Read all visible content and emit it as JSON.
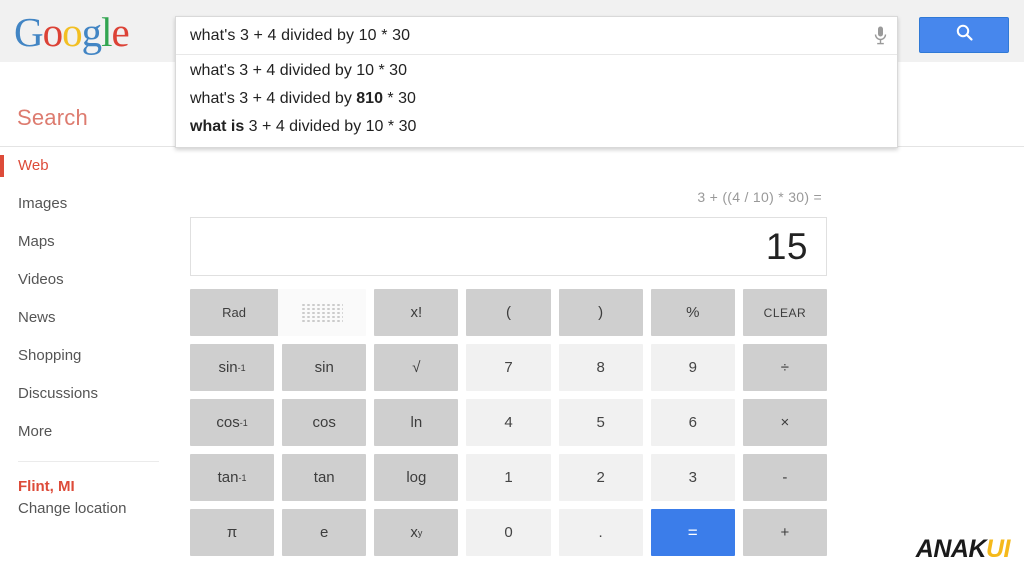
{
  "brand": {
    "logo_letters": [
      "G",
      "o",
      "o",
      "g",
      "l",
      "e"
    ],
    "colors": {
      "blue": "#4285c4",
      "red": "#dc4236",
      "yellow": "#f2bf23",
      "green": "#32a551",
      "accent_red": "#dd4b39",
      "button_blue": "#4787ed",
      "equals_blue": "#3b7dea"
    }
  },
  "header": {
    "search_label": "Search",
    "search_button_icon": "search-icon",
    "mic_icon": "microphone-icon"
  },
  "search": {
    "query": "what's 3 + 4 divided by 10 * 30",
    "placeholder": "Search",
    "suggestions": [
      {
        "plain_before": "what's 3 + 4 divided by 10 * 30",
        "bold": "",
        "plain_after": ""
      },
      {
        "plain_before": "what's 3 + 4 divided by ",
        "bold": "810",
        "plain_after": " * 30"
      },
      {
        "plain_before": "",
        "bold": "what is",
        "plain_after": " 3 + 4 divided by 10 * 30"
      }
    ]
  },
  "sidebar": {
    "items": [
      {
        "label": "Web",
        "active": true
      },
      {
        "label": "Images",
        "active": false
      },
      {
        "label": "Maps",
        "active": false
      },
      {
        "label": "Videos",
        "active": false
      },
      {
        "label": "News",
        "active": false
      },
      {
        "label": "Shopping",
        "active": false
      },
      {
        "label": "Discussions",
        "active": false
      },
      {
        "label": "More",
        "active": false
      }
    ],
    "location": {
      "name": "Flint, MI",
      "change_label": "Change location"
    }
  },
  "calculator": {
    "expression": "3 + ((4 / 10) * 30) =",
    "result": "15",
    "mode_toggle": {
      "active_label": "Rad",
      "inactive_label": "",
      "inactive_icon": "keypad-grid-icon"
    },
    "rows": [
      [
        {
          "label": "x!",
          "type": "fn"
        },
        {
          "label": "(",
          "type": "fn"
        },
        {
          "label": ")",
          "type": "fn"
        },
        {
          "label": "%",
          "type": "fn"
        },
        {
          "label": "CLEAR",
          "type": "fn",
          "small": true
        }
      ],
      [
        {
          "label": "sin",
          "sup": "-1",
          "type": "fn"
        },
        {
          "label": "sin",
          "type": "fn"
        },
        {
          "label": "√",
          "type": "fn"
        },
        {
          "label": "7",
          "type": "num"
        },
        {
          "label": "8",
          "type": "num"
        },
        {
          "label": "9",
          "type": "num"
        },
        {
          "label": "÷",
          "type": "fn"
        }
      ],
      [
        {
          "label": "cos",
          "sup": "-1",
          "type": "fn"
        },
        {
          "label": "cos",
          "type": "fn"
        },
        {
          "label": "ln",
          "type": "fn"
        },
        {
          "label": "4",
          "type": "num"
        },
        {
          "label": "5",
          "type": "num"
        },
        {
          "label": "6",
          "type": "num"
        },
        {
          "label": "×",
          "type": "fn"
        }
      ],
      [
        {
          "label": "tan",
          "sup": "-1",
          "type": "fn"
        },
        {
          "label": "tan",
          "type": "fn"
        },
        {
          "label": "log",
          "type": "fn"
        },
        {
          "label": "1",
          "type": "num"
        },
        {
          "label": "2",
          "type": "num"
        },
        {
          "label": "3",
          "type": "num"
        },
        {
          "label": "-",
          "type": "fn"
        }
      ],
      [
        {
          "label": "π",
          "type": "fn"
        },
        {
          "label": "e",
          "type": "fn"
        },
        {
          "label": "x",
          "sup": "y",
          "type": "fn"
        },
        {
          "label": "0",
          "type": "num"
        },
        {
          "label": ".",
          "type": "num"
        },
        {
          "label": "=",
          "type": "eq"
        },
        {
          "label": "+",
          "type": "fn"
        }
      ]
    ]
  },
  "watermark": {
    "dark_text": "ANAK",
    "accent_text": "UI"
  }
}
